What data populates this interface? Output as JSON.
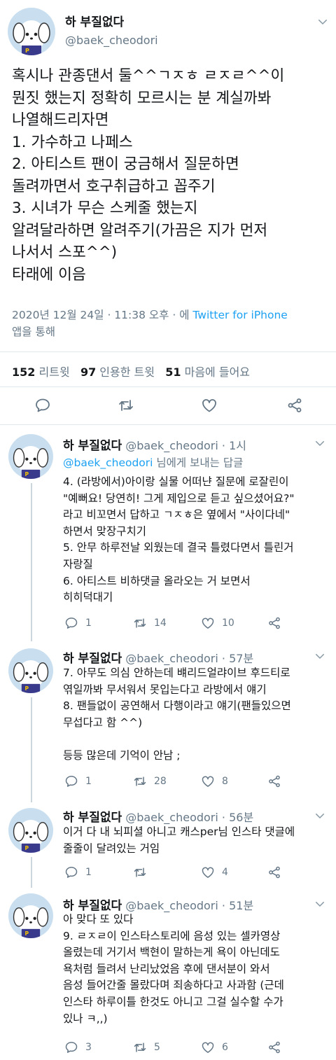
{
  "main_tweet": {
    "display_name": "하 부질없다",
    "handle": "@baek_cheodori",
    "lines": [
      "혹시나 관종댄서 둘^^ㄱㅈㅎ ㄹㅈㄹ^^이",
      "뭔짓 했는지 정확히 모르시는 분 계실까봐",
      "나열해드리자면",
      "1. 가수하고 나페스",
      "2. 아티스트 팬이 궁금해서 질문하면",
      "돌려까면서 호구취급하고 꼽주기",
      "3. 시녀가 무슨 스케줄 했는지",
      "알려달라하면 알려주기(가끔은 지가 먼저",
      "나서서 스포^^)",
      "타래에 이음"
    ],
    "timestamp": "2020년 12월 24일 · 11:38 오후 · 에",
    "via_link": "Twitter for iPhone",
    "via_suffix": "앱을 통해",
    "retweets_count": "152",
    "retweets_label": "리트윗",
    "quotes_count": "97",
    "quotes_label": "인용한 트윗",
    "likes_count": "51",
    "likes_label": "마음에 들어요"
  },
  "replies": [
    {
      "display_name": "하 부질없다",
      "handle_time": "@baek_cheodori · 1시",
      "reply_to_handle": "@baek_cheodori",
      "reply_to_suffix": "님에게 보내는 답글",
      "lines": [
        "4. (라방에서)아이랑 실물 어떠냔 질문에 로잘린이",
        "\"예뻐요! 당연히! 그게 제입으로 듣고 싶으셨어요?\"",
        "라고 비꼬면서 답하고 ㄱㅈㅎ은 옆에서 \"사이다네\"",
        "하면서 맞장구치기",
        "5. 안무 하루전날 외웠는데 결국 틀렸다면서 틀린거",
        "자랑질",
        "6. 아티스트 비하댓글 올라오는 거 보면서",
        "히히덕대기"
      ],
      "replies_count": "1",
      "retweets_count": "14",
      "likes_count": "10"
    },
    {
      "display_name": "하 부질없다",
      "handle_time": "@baek_cheodori · 57분",
      "lines": [
        "7. 아무도 의심 안하는데 뱨리드얼랴이브 후드티로",
        "엮일까봐 무서워서 못입는다고 라방에서 얘기",
        "8. 팬들없이 공연해서 다행이라고 얘기(팬들있으면",
        "무섭다고 함 ^^)",
        "",
        "등등 많은데 기억이 안남 ;"
      ],
      "replies_count": "1",
      "retweets_count": "28",
      "likes_count": "8"
    },
    {
      "display_name": "하 부질없다",
      "handle_time": "@baek_cheodori · 56분",
      "lines": [
        "이거 다 내 뇌피셜 아니고 캐스per님 인스타 댓글에",
        "줄줄이 달려있는 거임"
      ],
      "replies_count": "1",
      "retweets_count": "",
      "likes_count": "4"
    },
    {
      "display_name": "하 부질없다",
      "handle_time": "@baek_cheodori · 51분",
      "lines": [
        "아 맞다 또 있다",
        "9. ㄹㅈㄹ이 인스타스토리에 음성 있는 셀카영상",
        "올렸는데 거기서 백현이 말하는게 욕이 아닌데도",
        "욕처럼 들려서 난리났었음 후에 댄서분이 와서",
        "음성 들어간줄 몰랐다며 죄송하다고 사과함 (근데",
        "인스타 하루이틀 한것도 아니고 그걸 실수할 수가",
        "있나 ㅋ,,)"
      ],
      "replies_count": "3",
      "retweets_count": "5",
      "likes_count": "6"
    }
  ],
  "icons": {
    "reply": "speech-bubble-icon",
    "retweet": "retweet-icon",
    "like": "heart-icon",
    "share": "share-icon",
    "more": "chevron-down-icon"
  },
  "colors": {
    "accent": "#1da1f2",
    "text": "#14171a",
    "secondary": "#657786",
    "divider": "#e1e8ed",
    "avatar_bg": "#c9dff0"
  }
}
